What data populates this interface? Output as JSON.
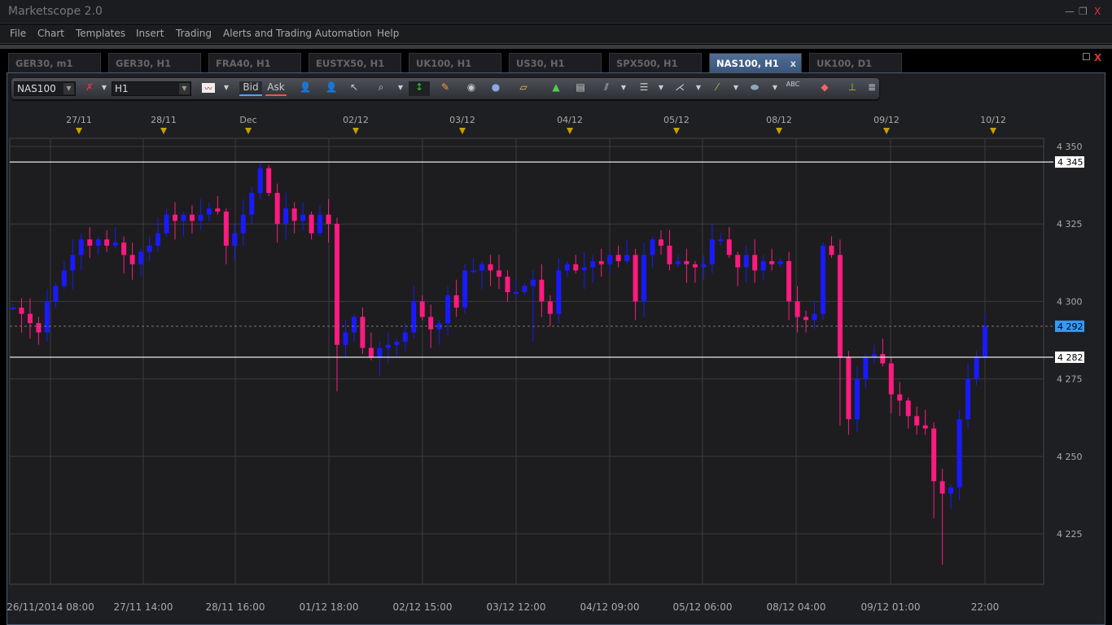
{
  "app": {
    "title": "Marketscope 2.0"
  },
  "window_controls": {
    "minimize": "—",
    "restore": "❐",
    "close": "X"
  },
  "menu": [
    "File",
    "Chart",
    "Templates",
    "Insert",
    "Trading",
    "Alerts and Trading Automation",
    "Help"
  ],
  "tabs": [
    {
      "label": "GER30, m1"
    },
    {
      "label": "GER30, H1"
    },
    {
      "label": "FRA40, H1"
    },
    {
      "label": "EUSTX50, H1"
    },
    {
      "label": "UK100, H1"
    },
    {
      "label": "US30, H1"
    },
    {
      "label": "SPX500, H1"
    },
    {
      "label": "NAS100, H1",
      "active": true,
      "close": "x"
    },
    {
      "label": "UK100, D1"
    }
  ],
  "panel_controls": {
    "maximize": "☐",
    "close": "X"
  },
  "toolbar": {
    "instrument": "NAS100",
    "timeframe": "H1",
    "bid": "Bid",
    "ask": "Ask",
    "abc": "ABC"
  },
  "colors": {
    "bull": "#1a1aff",
    "bear": "#ff1a80",
    "bg": "#1e1f23",
    "grid": "#3a3b3f",
    "current_price": "#3399ff"
  },
  "chart_data": {
    "type": "candlestick",
    "instrument": "NAS100",
    "timeframe": "H1",
    "ylim": [
      4205,
      4355
    ],
    "y_ticks": [
      "4 350",
      "4 325",
      "4 300",
      "4 275",
      "4 250",
      "4 225"
    ],
    "y_tick_values": [
      4350,
      4325,
      4300,
      4275,
      4250,
      4225
    ],
    "top_date_labels": [
      "27/11",
      "28/11",
      "Dec",
      "02/12",
      "03/12",
      "04/12",
      "05/12",
      "08/12",
      "09/12",
      "10/12"
    ],
    "bottom_time_labels": [
      "26/11/2014 08:00",
      "27/11 14:00",
      "28/11 16:00",
      "01/12 18:00",
      "02/12 15:00",
      "03/12 12:00",
      "04/12 09:00",
      "05/12 06:00",
      "08/12 04:00",
      "09/12 01:00",
      "22:00"
    ],
    "horizontal_lines": [
      {
        "value": 4345,
        "label": "4 345"
      },
      {
        "value": 4282,
        "label": "4 282"
      }
    ],
    "current_price": {
      "value": 4292,
      "label": "4 292"
    },
    "first_open": 4298,
    "closes": [
      4298,
      4296,
      4293,
      4290,
      4300,
      4305,
      4310,
      4315,
      4320,
      4318,
      4320,
      4318,
      4319,
      4315,
      4312,
      4316,
      4318,
      4322,
      4328,
      4326,
      4328,
      4326,
      4328,
      4330,
      4329,
      4318,
      4322,
      4328,
      4335,
      4343,
      4335,
      4325,
      4330,
      4326,
      4328,
      4322,
      4328,
      4325,
      4286,
      4290,
      4295,
      4285,
      4282,
      4285,
      4286,
      4287,
      4290,
      4300,
      4295,
      4291,
      4293,
      4302,
      4298,
      4310,
      4310,
      4312,
      4310,
      4308,
      4303,
      4303,
      4305,
      4307,
      4300,
      4296,
      4310,
      4312,
      4310,
      4311,
      4313,
      4312,
      4315,
      4313,
      4315,
      4300,
      4315,
      4320,
      4318,
      4312,
      4313,
      4312,
      4311,
      4312,
      4320,
      4320,
      4315,
      4311,
      4315,
      4310,
      4313,
      4312,
      4313,
      4300,
      4295,
      4294,
      4296,
      4318,
      4315,
      4282,
      4262,
      4275,
      4282,
      4283,
      4280,
      4270,
      4268,
      4263,
      4260,
      4259,
      4242,
      4238,
      4240,
      4262,
      4275,
      4282,
      4292
    ]
  }
}
